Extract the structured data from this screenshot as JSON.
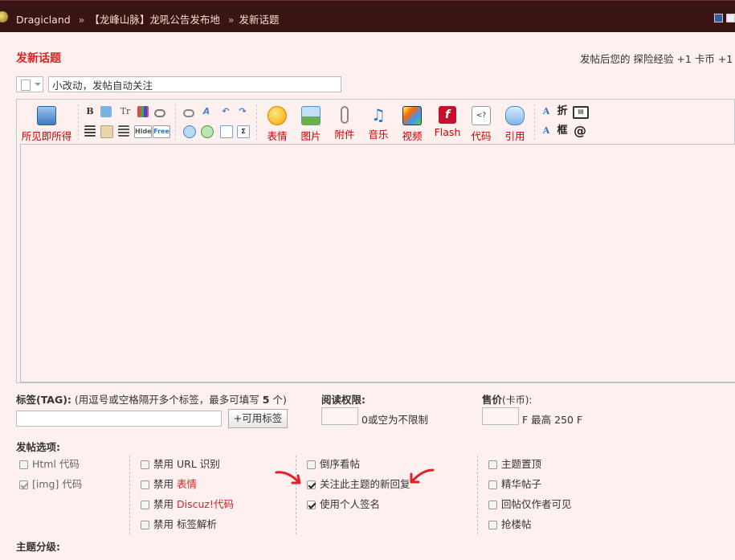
{
  "breadcrumb": {
    "site": "Dragicland",
    "sep": "»",
    "forum": "【龙峰山脉】龙吼公告发布地",
    "page": "发新话题"
  },
  "title": "发新话题",
  "experience_note": "发帖后您的 探险经验 +1  卡币 +1",
  "subject": {
    "value": "小改动，发帖自动关注"
  },
  "toolbar": {
    "wysiwyg": "所见即所得",
    "emoticon": "表情",
    "image": "图片",
    "attachment": "附件",
    "music": "音乐",
    "video": "视频",
    "flash": "Flash",
    "code": "代码",
    "quote": "引用",
    "bold_glyph": "B",
    "tt_glyph": "Tr",
    "hide_glyph": "Hide",
    "free_glyph": "Free",
    "fold_glyph": "折",
    "box_glyph": "框",
    "at_glyph": "@"
  },
  "tags": {
    "label": "标签(TAG):",
    "hint": "(用逗号或空格隔开多个标签，最多可填写 ",
    "max": "5",
    "hint_end": " 个)",
    "button": "+可用标签"
  },
  "read_perm": {
    "label": "阅读权限:",
    "note": "0或空为不限制"
  },
  "price": {
    "label": "售价",
    "unit": "(卡币):",
    "note": "F 最高 250 F"
  },
  "options": {
    "label": "发帖选项:",
    "col1": [
      {
        "text": "Html 代码",
        "checked": false
      },
      {
        "text": "[img] 代码",
        "checked": true
      }
    ],
    "col2": [
      {
        "prefix": "禁用 ",
        "text": "URL 识别"
      },
      {
        "prefix": "禁用 ",
        "text": "表情"
      },
      {
        "prefix": "禁用 ",
        "text": "Discuz!代码"
      },
      {
        "prefix": "禁用 ",
        "text": "标签解析"
      }
    ],
    "col3": [
      {
        "text": "倒序看帖",
        "checked": false
      },
      {
        "text": "关注此主题的新回复",
        "checked": true
      },
      {
        "text": "使用个人签名",
        "checked": true
      }
    ],
    "col4": [
      {
        "text": "主题置顶"
      },
      {
        "text": "精华帖子"
      },
      {
        "text": "回帖仅作者可见"
      },
      {
        "text": "抢楼帖"
      }
    ]
  },
  "grade_label": "主题分级:",
  "colors": {
    "topbar": "#3a1414",
    "accent_red": "#dd2222",
    "page_bg": "#fdf0ee"
  }
}
